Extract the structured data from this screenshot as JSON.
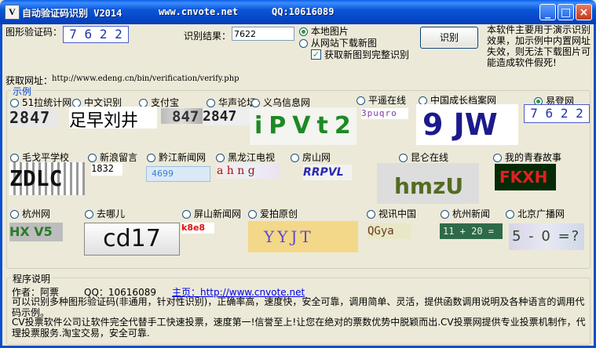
{
  "window": {
    "app_name": "自动验证码识别 V2014",
    "site": "www.cnvote.net",
    "qq": "QQ:10616089",
    "buttons": {
      "minimize": "_",
      "maximize": "□",
      "close": "×"
    }
  },
  "top": {
    "captcha_label": "图形验证码：",
    "captcha_sample": "7 6 2 2",
    "result_label": "识别结果：",
    "result_value": "7622",
    "source_local": "本地图片",
    "source_web": "从网站下载新图",
    "fetch_full": "获取新图到完整识别",
    "recognize_button": "识别",
    "note": "本软件主要用于演示识别效果，加示例中内置网址失效，则无法下载图片可能造成软件假死!",
    "url_label": "获取网址：",
    "url_value": "http://www.edeng.cn/bin/verification/verify.php"
  },
  "examples": {
    "legend": "示例",
    "row1": [
      {
        "label": "51拉统计网",
        "selected": false,
        "captcha": "2847"
      },
      {
        "label": "中文识别",
        "selected": false,
        "captcha": "足早刘井"
      },
      {
        "label": "支付宝",
        "selected": false,
        "captcha": "847"
      },
      {
        "label": "华声论坛",
        "selected": false,
        "captcha": "2847"
      },
      {
        "label": "义乌信息网",
        "selected": false,
        "captcha": "iPVt2"
      },
      {
        "label": "平遥在线",
        "selected": false,
        "captcha": "3puqro"
      },
      {
        "label": "中国成长档案网",
        "selected": false,
        "captcha": "9 JW"
      },
      {
        "label": "易登网",
        "selected": true,
        "captcha": "7 6 2 2"
      }
    ],
    "row2": [
      {
        "label": "毛戈平学校",
        "selected": false,
        "captcha": "ZDLC"
      },
      {
        "label": "新浪留言",
        "selected": false,
        "captcha": "1832"
      },
      {
        "label": "黔江新闻网",
        "selected": false,
        "captcha": "4699"
      },
      {
        "label": "黑龙江电视",
        "selected": false,
        "captcha": "a h n g"
      },
      {
        "label": "房山网",
        "selected": false,
        "captcha": "RRPVL"
      },
      {
        "label": "昆仑在线",
        "selected": false,
        "captcha": "hmzU"
      },
      {
        "label": "我的青春故事",
        "selected": false,
        "captcha": "FKXH"
      }
    ],
    "row3": [
      {
        "label": "杭州网",
        "selected": false,
        "captcha": "HX V5"
      },
      {
        "label": "去哪儿",
        "selected": false,
        "captcha": "cd17"
      },
      {
        "label": "屏山新闻网",
        "selected": false,
        "captcha": "k8e8"
      },
      {
        "label": "爱拍原创",
        "selected": false,
        "captcha": "YYJT"
      },
      {
        "label": "视讯中国",
        "selected": false,
        "captcha": "QGya"
      },
      {
        "label": "杭州新闻",
        "selected": false,
        "captcha": "11 + 20 ="
      },
      {
        "label": "北京广播网",
        "selected": false,
        "captcha": "5 - 0 =?"
      }
    ]
  },
  "program": {
    "legend": "程序说明",
    "author": "作者：阿票",
    "qq": "QQ：10616089",
    "homepage": "主页：http://www.cnvote.net",
    "line1": "可以识别多种图形验证码(非通用，针对性识别)，正确率高，速度快，安全可靠，调用简单、灵活，提供函数调用说明及各种语言的调用代码示例。",
    "line2": "CV投票软件公司让软件完全代替手工快速投票，速度第一!信誉至上!让您在绝对的票数优势中脱颖而出.CV投票网提供专业投票机制作，代理投票服务.淘宝交易，安全可靠."
  }
}
